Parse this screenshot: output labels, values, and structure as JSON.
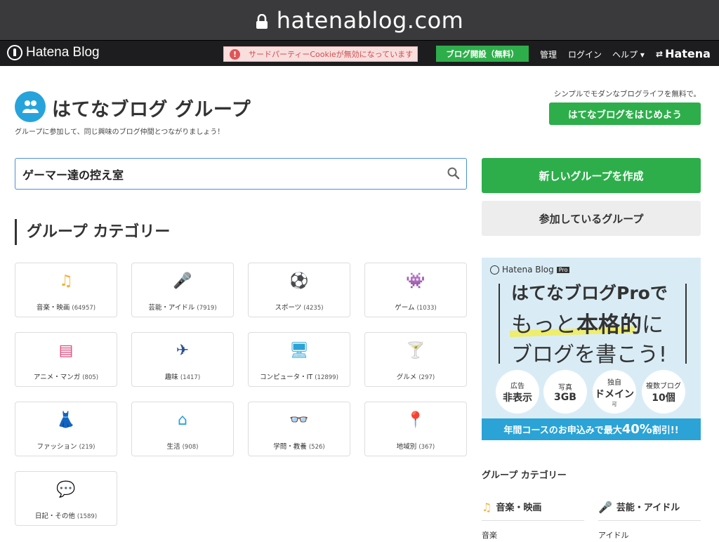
{
  "browser": {
    "url": "hatenablog.com"
  },
  "topbar": {
    "logo": "Hatena Blog",
    "cookie_warning": "サードパーティーCookieが無効になっています",
    "start_blog": "ブログ開設（無料）",
    "nav": [
      "管理",
      "ログイン",
      "ヘルプ ▾"
    ],
    "hatena": "Hatena"
  },
  "header": {
    "title": "はてなブログ グループ",
    "subtitle": "グループに参加して、同じ興味のブログ仲間とつながりましょう！",
    "promo_text": "シンプルでモダンなブログライフを無料で。",
    "promo_button": "はてなブログをはじめよう"
  },
  "search": {
    "value": "ゲーマー達の控え室"
  },
  "buttons": {
    "create": "新しいグループを作成",
    "joined": "参加しているグループ"
  },
  "categories_heading": "グループ カテゴリー",
  "categories": [
    {
      "label": "音楽・映画",
      "count": "(64957)",
      "icon": "music-note-icon",
      "glyph": "♫",
      "color": "#f2b13b"
    },
    {
      "label": "芸能・アイドル",
      "count": "(7919)",
      "icon": "microphone-icon",
      "glyph": "🎤",
      "color": "#e0487a"
    },
    {
      "label": "スポーツ",
      "count": "(4235)",
      "icon": "soccer-ball-icon",
      "glyph": "⚽",
      "color": "#2a4e8c"
    },
    {
      "label": "ゲーム",
      "count": "(1033)",
      "icon": "space-invader-icon",
      "glyph": "👾",
      "color": "#2ba3d6"
    },
    {
      "label": "アニメ・マンガ",
      "count": "(805)",
      "icon": "manga-book-icon",
      "glyph": "▤",
      "color": "#e0487a"
    },
    {
      "label": "趣味",
      "count": "(1417)",
      "icon": "airplane-icon",
      "glyph": "✈",
      "color": "#2a4e8c"
    },
    {
      "label": "コンピュータ・IT",
      "count": "(12899)",
      "icon": "monitor-icon",
      "glyph": "🖥",
      "color": "#2ba3d6"
    },
    {
      "label": "グルメ",
      "count": "(297)",
      "icon": "cocktail-icon",
      "glyph": "🍸",
      "color": "#f2b13b"
    },
    {
      "label": "ファッション",
      "count": "(219)",
      "icon": "dress-icon",
      "glyph": "👗",
      "color": "#e0487a"
    },
    {
      "label": "生活",
      "count": "(908)",
      "icon": "house-icon",
      "glyph": "⌂",
      "color": "#2ba3d6"
    },
    {
      "label": "学問・教養",
      "count": "(526)",
      "icon": "glasses-icon",
      "glyph": "👓",
      "color": "#2a4e8c"
    },
    {
      "label": "地域別",
      "count": "(367)",
      "icon": "map-pin-icon",
      "glyph": "📍",
      "color": "#f2b13b"
    },
    {
      "label": "日記・その他",
      "count": "(1589)",
      "icon": "speech-bubbles-icon",
      "glyph": "💬",
      "color": "#e0487a"
    }
  ],
  "ad": {
    "logo": "Hatena Blog",
    "pro_tag": "Pro",
    "line1": "はてなブログProで",
    "line2_pre": "もっと",
    "line2_bold": "本格的",
    "line2_post": "に",
    "line3": "ブログを書こう!",
    "features": [
      {
        "small": "広告",
        "big": "非表示",
        "extra": ""
      },
      {
        "small": "写真",
        "big": "3GB",
        "extra": ""
      },
      {
        "small": "独自",
        "big": "ドメイン",
        "extra": "可"
      },
      {
        "small": "複数ブログ",
        "big": "10個",
        "extra": ""
      }
    ],
    "band_pre": "年間コースのお申込みで最大",
    "band_pct": "40%",
    "band_post": "割引!!"
  },
  "sidebar": {
    "title": "グループ カテゴリー",
    "cats": [
      {
        "label": "音楽・映画",
        "sub": "音楽",
        "glyph": "♫",
        "color": "#f2b13b"
      },
      {
        "label": "芸能・アイドル",
        "sub": "アイドル",
        "glyph": "🎤",
        "color": "#e0487a"
      }
    ]
  }
}
